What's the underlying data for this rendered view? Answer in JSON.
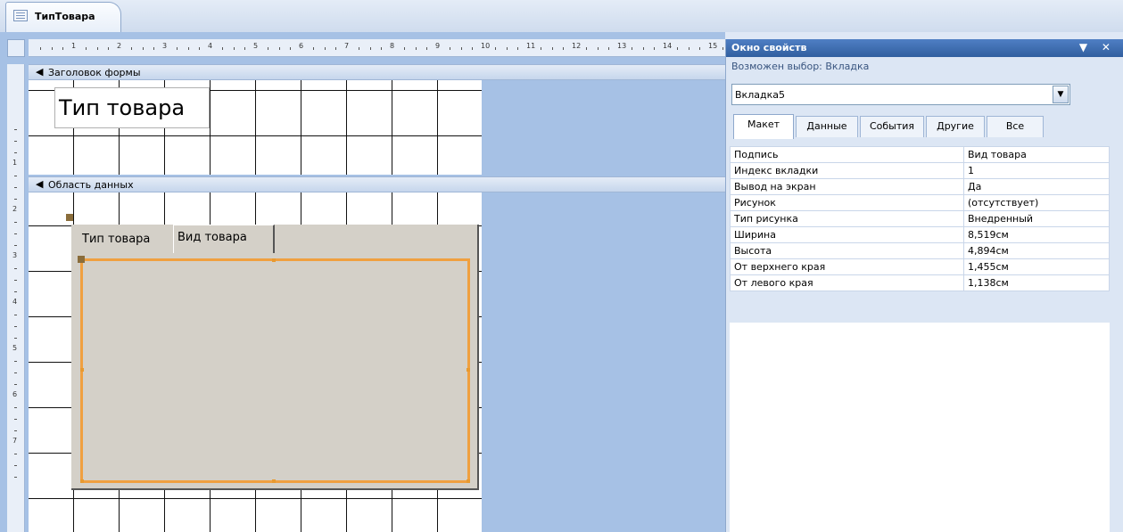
{
  "document_tab": {
    "title": "ТипТовара",
    "icon": "form-icon"
  },
  "ruler": {
    "horizontal_numbers": [
      "1",
      "2",
      "3",
      "4",
      "5",
      "6",
      "7",
      "8",
      "9",
      "10",
      "11",
      "12",
      "13",
      "14",
      "15"
    ],
    "vertical_numbers": [
      "1",
      "2",
      "3",
      "4",
      "5",
      "6",
      "7"
    ]
  },
  "sections": {
    "header": {
      "label": "Заголовок формы",
      "arrow": "◀"
    },
    "detail": {
      "label": "Область данных",
      "arrow": "◀"
    }
  },
  "form": {
    "title_label": "Тип товара",
    "tab_control": {
      "tabs": [
        {
          "label": "Тип товара",
          "active": false
        },
        {
          "label": "Вид товара",
          "active": true
        }
      ]
    }
  },
  "property_sheet": {
    "title": "Окно свойств",
    "header_buttons": "▼ ✕",
    "selection_type_text": "Возможен выбор:  Вкладка",
    "selected_object": "Вкладка5",
    "tabs": [
      {
        "label": "Макет",
        "active": true
      },
      {
        "label": "Данные",
        "active": false
      },
      {
        "label": "События",
        "active": false
      },
      {
        "label": "Другие",
        "active": false
      },
      {
        "label": "Все",
        "active": false
      }
    ],
    "properties": [
      {
        "name": "Подпись",
        "value": "Вид товара"
      },
      {
        "name": "Индекс вкладки",
        "value": "1"
      },
      {
        "name": "Вывод на экран",
        "value": "Да"
      },
      {
        "name": "Рисунок",
        "value": "(отсутствует)"
      },
      {
        "name": "Тип рисунка",
        "value": "Внедренный"
      },
      {
        "name": "Ширина",
        "value": "8,519см"
      },
      {
        "name": "Высота",
        "value": "4,894см"
      },
      {
        "name": "От верхнего края",
        "value": "1,455см"
      },
      {
        "name": "От левого края",
        "value": "1,138см"
      }
    ]
  },
  "colors": {
    "selection_orange": "#f0a040",
    "designer_background": "#a6c1e5",
    "property_header": "#315f9f"
  }
}
